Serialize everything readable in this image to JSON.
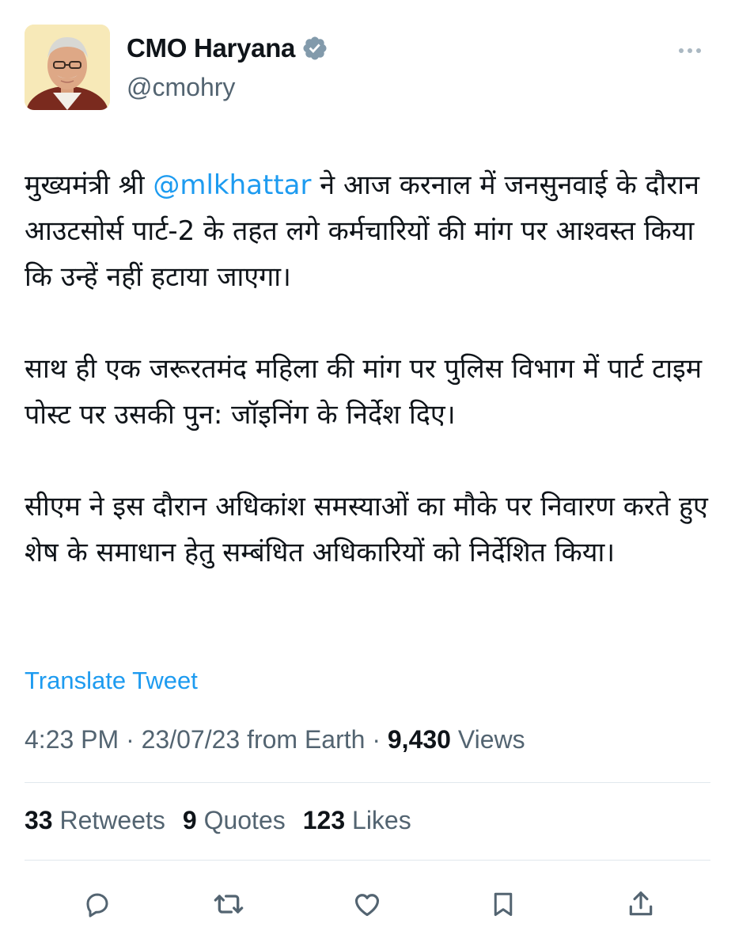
{
  "author": {
    "display_name": "CMO Haryana",
    "handle": "@cmohry",
    "verified_icon": "verified-badge-icon",
    "avatar_icon": "profile-avatar"
  },
  "tweet": {
    "para1_pre": "मुख्यमंत्री श्री ",
    "mention": "@mlkhattar",
    "para1_post": " ने आज करनाल में जनसुनवाई के दौरान आउटसोर्स पार्ट-2 के तहत लगे कर्मचारियों की मांग पर आश्वस्त किया कि उन्हें नहीं हटाया जाएगा।",
    "para2": "साथ ही एक जरूरतमंद महिला की मांग पर पुलिस विभाग में पार्ट टाइम पोस्ट पर उसकी पुन: जॉइनिंग के निर्देश दिए।",
    "para3": "सीएम ने इस दौरान अधिकांश समस्याओं का मौके पर निवारण करते हुए शेष के समाधान हेतु सम्बंधित अधिकारियों को निर्देशित किया।",
    "translate_label": "Translate Tweet"
  },
  "meta": {
    "time": "4:23 PM",
    "date": "23/07/23",
    "source": "from Earth",
    "separator": "·",
    "views_count": "9,430",
    "views_label": "Views"
  },
  "stats": {
    "retweets_count": "33",
    "retweets_label": "Retweets",
    "quotes_count": "9",
    "quotes_label": "Quotes",
    "likes_count": "123",
    "likes_label": "Likes"
  },
  "actions": [
    "reply-icon",
    "retweet-icon",
    "like-icon",
    "bookmark-icon",
    "share-icon"
  ],
  "colors": {
    "accent": "#1d9bf0",
    "secondary_text": "#536471",
    "primary_text": "#0f1419",
    "divider": "#e1e8ed"
  }
}
